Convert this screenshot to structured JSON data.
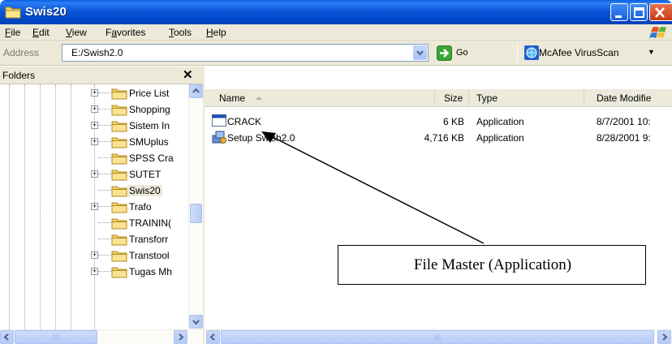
{
  "window": {
    "title": "Swis20"
  },
  "menu": {
    "items": [
      {
        "first": "F",
        "rest": "ile"
      },
      {
        "first": "E",
        "rest": "dit"
      },
      {
        "first": "V",
        "rest": "iew"
      },
      {
        "first": "",
        "mid": "a",
        "pre": "F",
        "rest": "vorites"
      },
      {
        "first": "T",
        "rest": "ools"
      },
      {
        "first": "H",
        "rest": "elp"
      }
    ]
  },
  "address": {
    "label": "Address",
    "value": "E:/Swish2.0",
    "go_label": "Go",
    "mcafee_label": "McAfee VirusScan"
  },
  "folders": {
    "title": "Folders",
    "close_glyph": "✕",
    "items": [
      {
        "label": "Price List",
        "expandable": true
      },
      {
        "label": "Shopping",
        "expandable": true
      },
      {
        "label": "Sistem In",
        "expandable": true
      },
      {
        "label": "SMUplus",
        "expandable": true
      },
      {
        "label": "SPSS Cra",
        "expandable": false
      },
      {
        "label": "SUTET",
        "expandable": true
      },
      {
        "label": "Swis20",
        "expandable": false,
        "selected": true
      },
      {
        "label": "Trafo",
        "expandable": true
      },
      {
        "label": "TRAININ(",
        "expandable": false
      },
      {
        "label": "Transforr",
        "expandable": false
      },
      {
        "label": "Transtool",
        "expandable": true
      },
      {
        "label": "Tugas Mh",
        "expandable": true
      }
    ]
  },
  "list": {
    "columns": {
      "name": "Name",
      "size": "Size",
      "type": "Type",
      "date": "Date Modifie"
    },
    "rows": [
      {
        "name": "CRACK",
        "size": "6 KB",
        "type": "Application",
        "date": "8/7/2001 10:",
        "icon": "app-window-icon"
      },
      {
        "name": "Setup Swish2.0",
        "size": "4,716 KB",
        "type": "Application",
        "date": "8/28/2001 9:",
        "icon": "setup-icon"
      }
    ]
  },
  "annotation": {
    "text": "File Master (Application)"
  },
  "colors": {
    "titlebar": "#0a55d8",
    "chrome": "#ece9d8",
    "close": "#c63b16"
  }
}
